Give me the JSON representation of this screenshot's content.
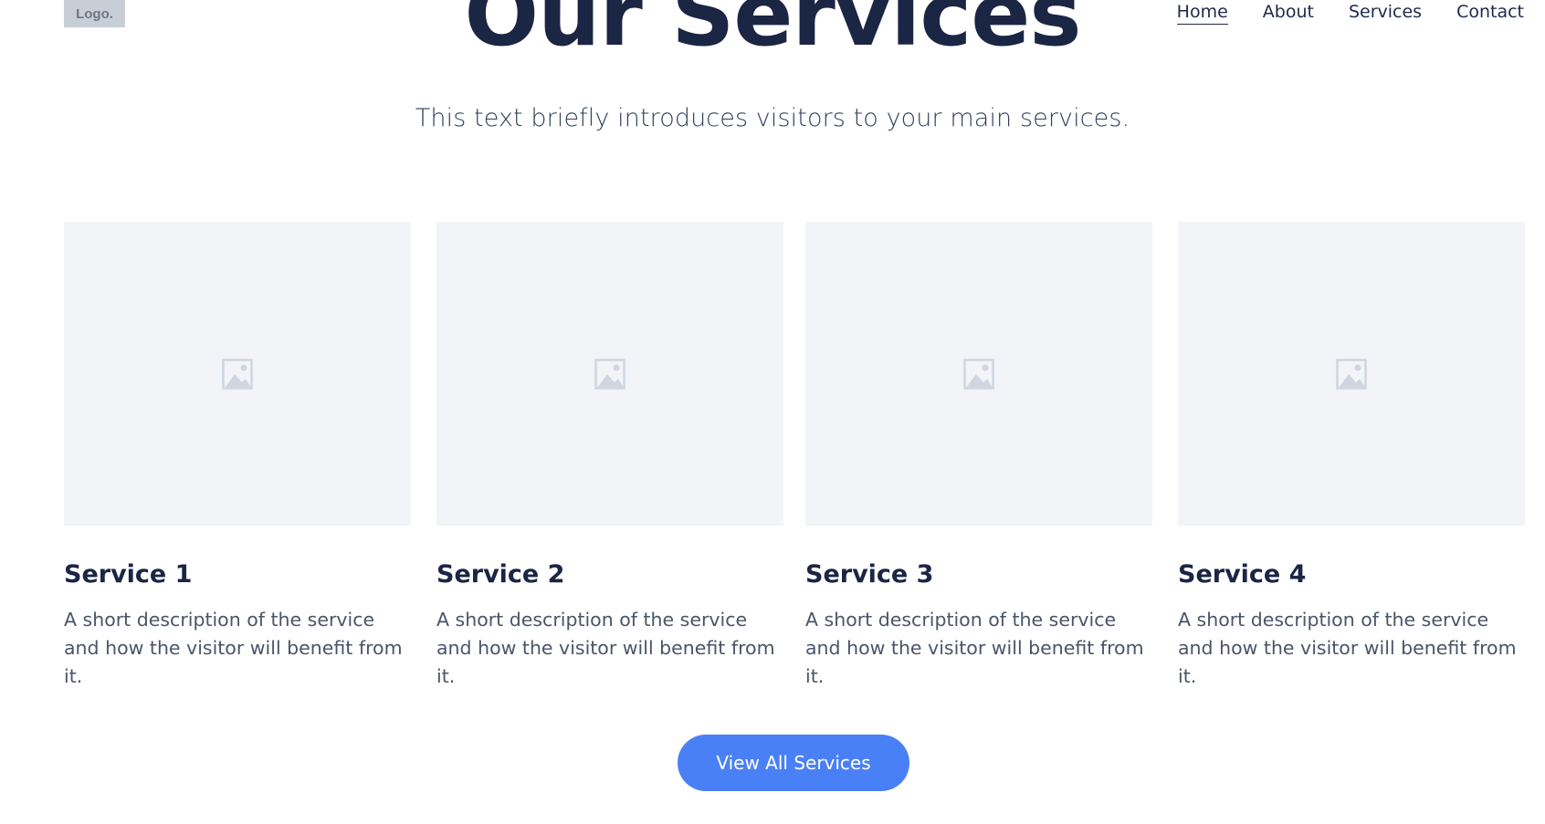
{
  "header": {
    "logo_text": "Logo.",
    "nav": [
      {
        "label": "Home",
        "active": true
      },
      {
        "label": "About",
        "active": false
      },
      {
        "label": "Services",
        "active": false
      },
      {
        "label": "Contact",
        "active": false
      }
    ]
  },
  "hero": {
    "title": "Our Services",
    "intro": "This text briefly introduces visitors to your main services."
  },
  "services": [
    {
      "title": "Service 1",
      "description": "A short description of the service and how the visitor will benefit from it.",
      "image_icon": "image-placeholder-icon"
    },
    {
      "title": "Service 2",
      "description": "A short description of the service and how the visitor will benefit from it.",
      "image_icon": "image-placeholder-icon"
    },
    {
      "title": "Service 3",
      "description": "A short description of the service and how the visitor will benefit from it.",
      "image_icon": "image-placeholder-icon"
    },
    {
      "title": "Service 4",
      "description": "A short description of the service and how the visitor will benefit from it.",
      "image_icon": "image-placeholder-icon"
    }
  ],
  "cta": {
    "label": "View All Services"
  },
  "colors": {
    "heading": "#1b2544",
    "accent_button": "#4a80f5",
    "placeholder_bg": "#f2f4f7",
    "logo_bg": "#c7ced6"
  }
}
